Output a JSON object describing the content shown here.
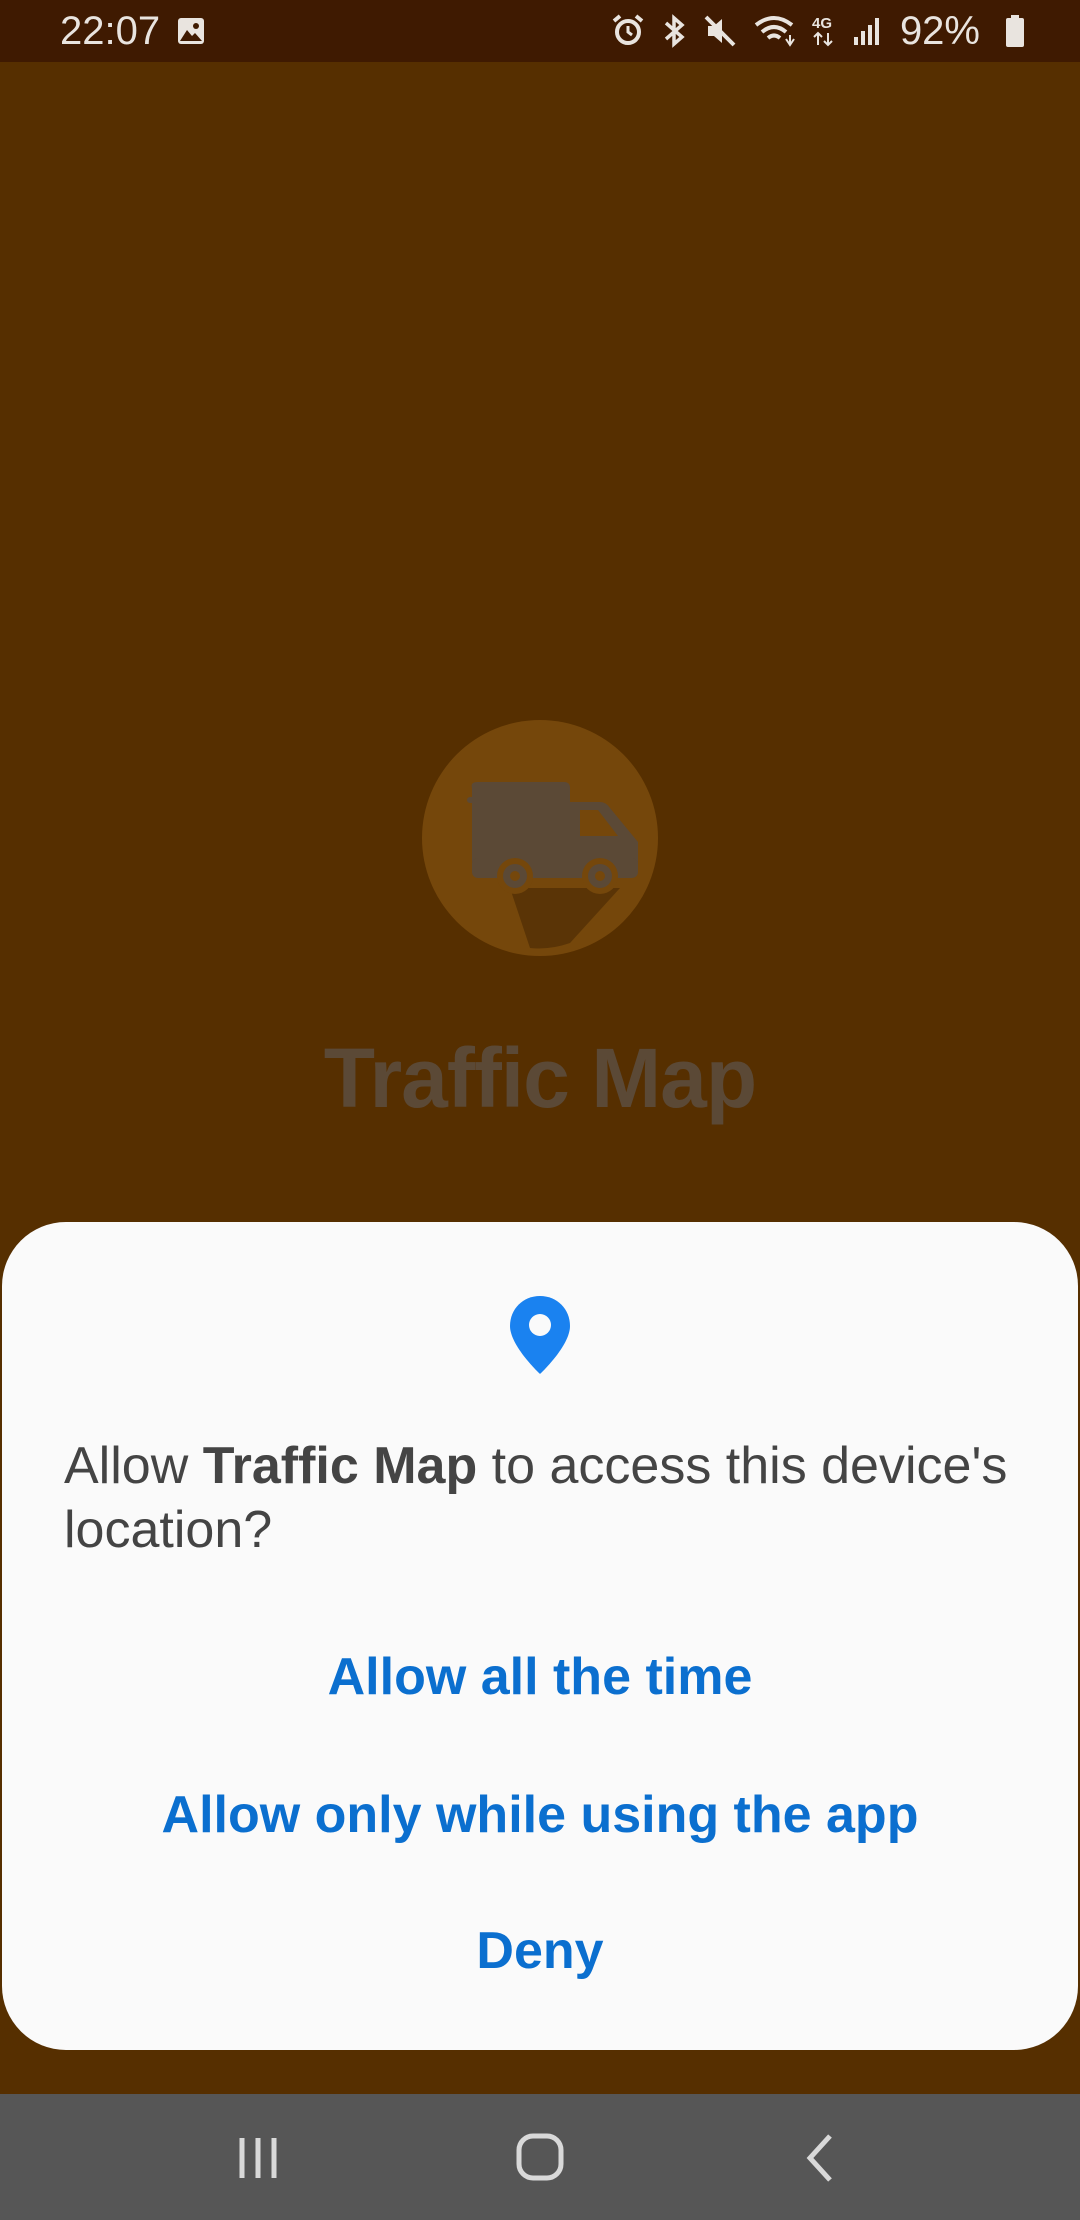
{
  "status_bar": {
    "time": "22:07",
    "battery_percent": "92%",
    "network_type": "4G",
    "icons": [
      "gallery-icon",
      "alarm-icon",
      "bluetooth-icon",
      "mute-icon",
      "wifi-icon",
      "mobile-data-icon",
      "signal-icon",
      "battery-icon"
    ]
  },
  "app": {
    "name": "Traffic Map",
    "logo_icon": "delivery-truck-icon"
  },
  "permission_dialog": {
    "icon": "location-pin-icon",
    "message_prefix": "Allow ",
    "message_app_name": "Traffic Map",
    "message_suffix": " to access this device's location?",
    "buttons": {
      "allow_always": "Allow all the time",
      "allow_while_using": "Allow only while using the app",
      "deny": "Deny"
    }
  },
  "nav_bar": {
    "buttons": [
      "recents-icon",
      "home-icon",
      "back-icon"
    ]
  },
  "colors": {
    "background_dimmed": "#562f00",
    "status_bar": "#3f1a01",
    "dialog_bg": "#fafafa",
    "accent": "#0b6fcf",
    "pin": "#1a82f0",
    "nav_bar": "#565656"
  }
}
